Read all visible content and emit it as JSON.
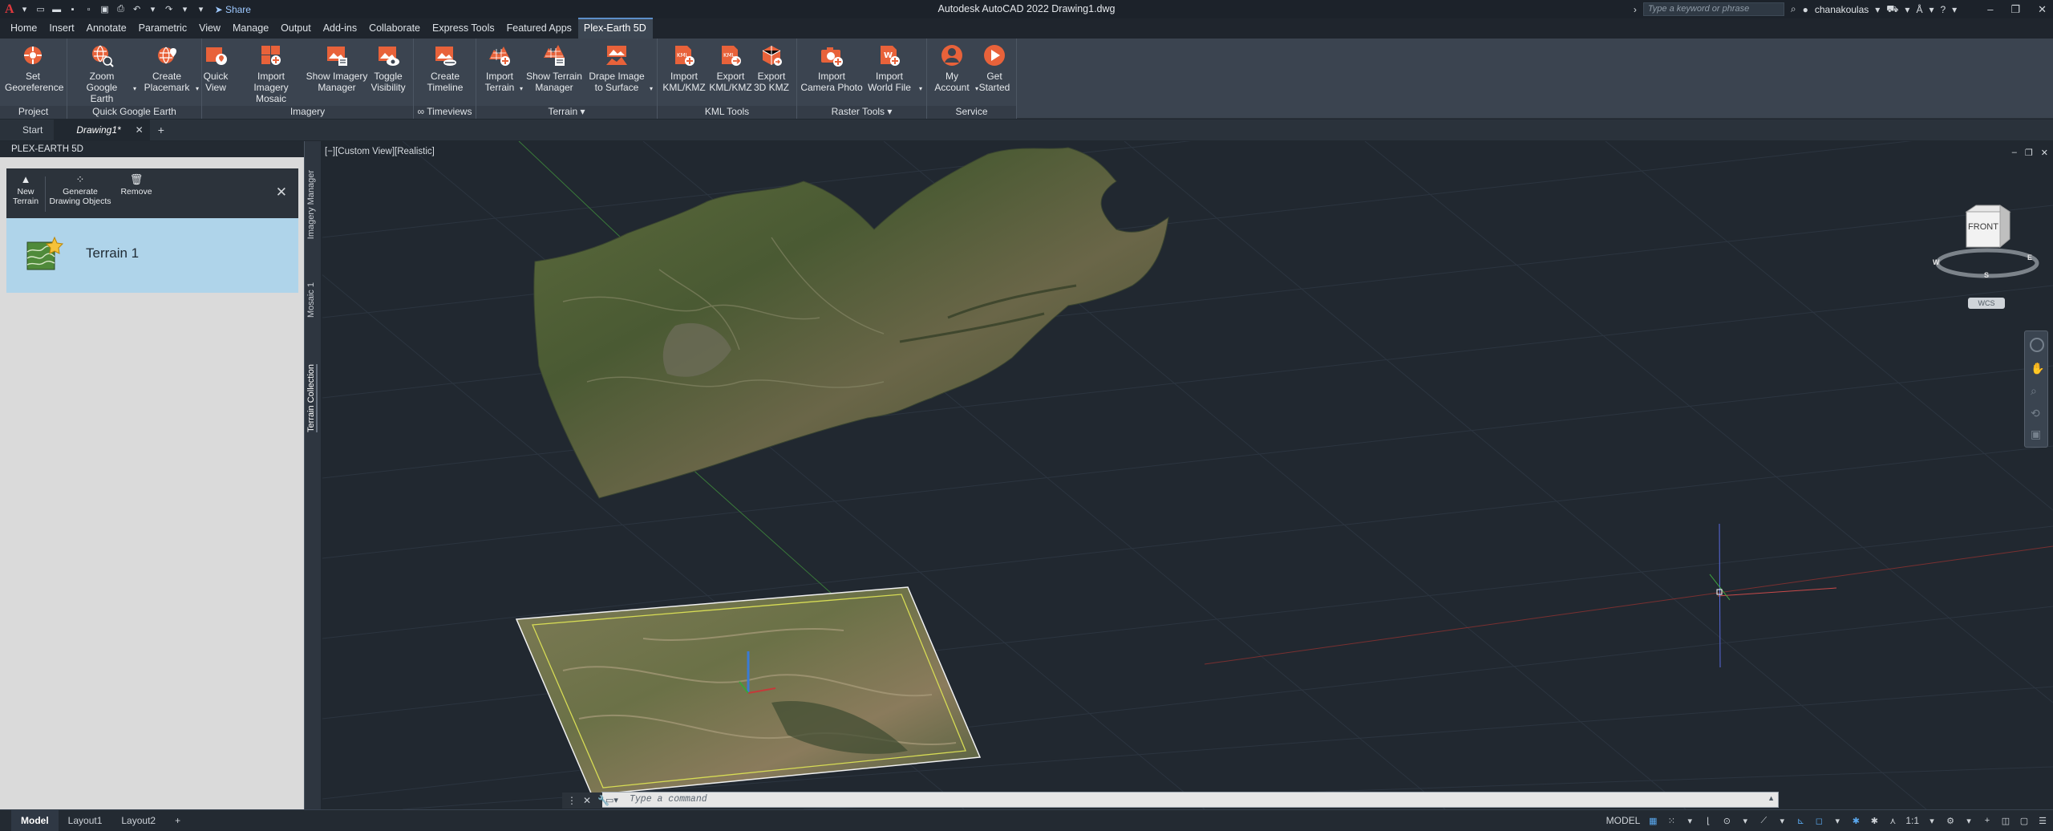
{
  "title_bar": {
    "app_title": "Autodesk AutoCAD 2022   Drawing1.dwg",
    "share_label": "Share",
    "search_placeholder": "Type a keyword or phrase",
    "username": "chanakoulas"
  },
  "menu": {
    "items": [
      "Home",
      "Insert",
      "Annotate",
      "Parametric",
      "View",
      "Manage",
      "Output",
      "Add-ins",
      "Collaborate",
      "Express Tools",
      "Featured Apps",
      "Plex-Earth 5D"
    ],
    "active_index": 11
  },
  "ribbon": {
    "panels": {
      "project": "Project",
      "quick_google_earth": "Quick Google Earth",
      "imagery": "Imagery",
      "timeviews": "∞ Timeviews",
      "terrain": "Terrain ▾",
      "kml_tools": "KML Tools",
      "raster_tools": "Raster Tools ▾",
      "service": "Service"
    },
    "tools": {
      "set_georeference": "Set\nGeoreference",
      "zoom_google_earth": "Zoom\nGoogle Earth",
      "create_placemark": "Create\nPlacemark",
      "quick_view": "Quick\nView",
      "import_imagery_mosaic": "Import Imagery\nMosaic",
      "show_imagery_manager": "Show Imagery\nManager",
      "toggle_visibility": "Toggle\nVisibility",
      "create_timeline": "Create\nTimeline",
      "import_terrain": "Import\nTerrain",
      "show_terrain_manager": "Show Terrain\nManager",
      "drape_image": "Drape Image\nto Surface",
      "import_kml": "Import\nKML/KMZ",
      "export_kml": "Export\nKML/KMZ",
      "export_3d_kmz": "Export\n3D KMZ",
      "import_camera_photo": "Import\nCamera Photo",
      "import_world_file": "Import\nWorld File",
      "my_account": "My\nAccount",
      "get_started": "Get\nStarted"
    }
  },
  "doc_tabs": {
    "start": "Start",
    "drawing": "Drawing1*"
  },
  "palette": {
    "title": "PLEX-EARTH 5D",
    "new_terrain": "New\nTerrain",
    "generate_drawing_objects": "Generate\nDrawing Objects",
    "remove": "Remove",
    "terrain_name": "Terrain 1",
    "side_tabs": [
      "Imagery Manager",
      "Mosaic 1",
      "Terrain Collection"
    ]
  },
  "viewport": {
    "label": "[−][Custom View][Realistic]",
    "viewcube_face": "FRONT",
    "wcs": "WCS",
    "compass": {
      "s": "S",
      "w": "W",
      "e": "E"
    }
  },
  "command_line": {
    "placeholder": "Type a command"
  },
  "status": {
    "layouts": [
      "Model",
      "Layout1",
      "Layout2"
    ],
    "mode": "MODEL",
    "scale": "1:1"
  },
  "colors": {
    "accent": "#e8623a",
    "ribbon_bg": "#3b4450",
    "viewport_bg": "#212830",
    "palette_selected": "#afd4ea"
  }
}
